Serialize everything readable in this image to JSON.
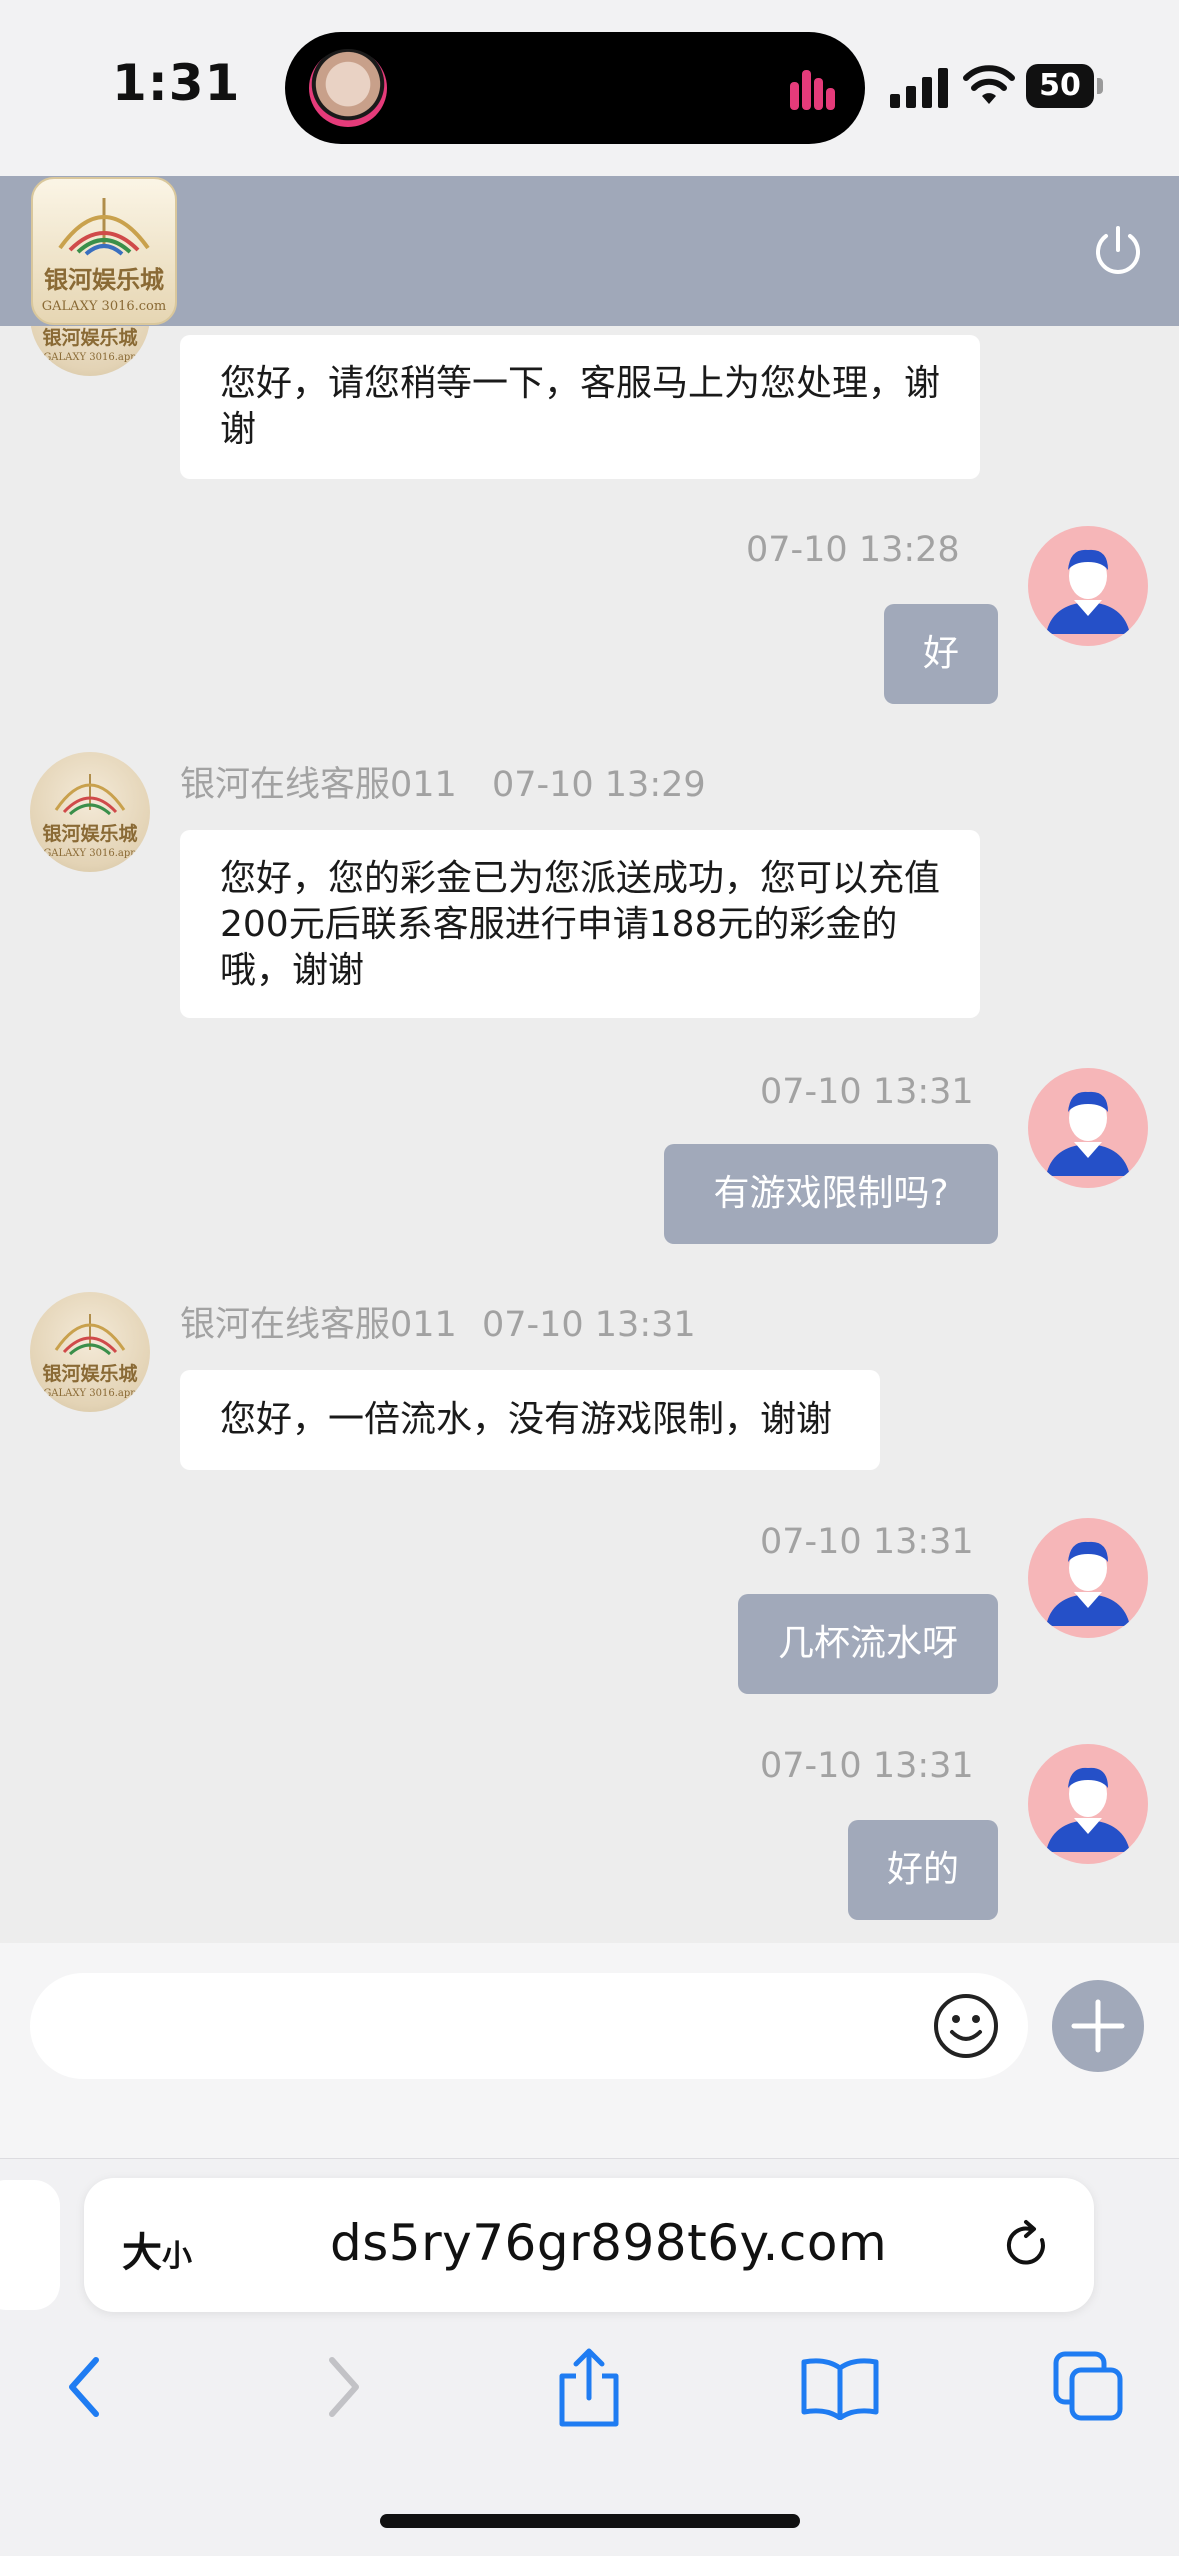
{
  "status_bar": {
    "time": "1:31",
    "battery": "50",
    "accent_color": "#e53b7a"
  },
  "header": {
    "logo_title": "银河娱乐城",
    "logo_subtitle": "GALAXY 3016.com",
    "background": "#a0a8b9"
  },
  "messages": [
    {
      "from": "agent",
      "text": "您好，请您稍等一下，客服马上为您处理，谢谢"
    },
    {
      "from": "user",
      "time": "07-10 13:28",
      "text": "好"
    },
    {
      "from": "agent",
      "name": "银河在线客服011",
      "time": "07-10 13:29",
      "text": "您好，您的彩金已为您派送成功，您可以充值200元后联系客服进行申请188元的彩金的哦，谢谢"
    },
    {
      "from": "user",
      "time": "07-10 13:31",
      "text": "有游戏限制吗?"
    },
    {
      "from": "agent",
      "name": "银河在线客服011",
      "time": "07-10 13:31",
      "text": "您好，一倍流水，没有游戏限制，谢谢"
    },
    {
      "from": "user",
      "time": "07-10 13:31",
      "text": "几杯流水呀"
    },
    {
      "from": "user",
      "time": "07-10 13:31",
      "text": "好的"
    }
  ],
  "avatar_logo_text": "银河娱乐城",
  "avatar_logo_sub": "GALAXY 3016.app",
  "composer": {
    "placeholder": "",
    "emoji_icon": "smile-icon",
    "add_icon": "plus-icon"
  },
  "browser": {
    "text_size_large": "大",
    "text_size_small": "小",
    "url": "ds5ry76gr898t6y.com"
  }
}
